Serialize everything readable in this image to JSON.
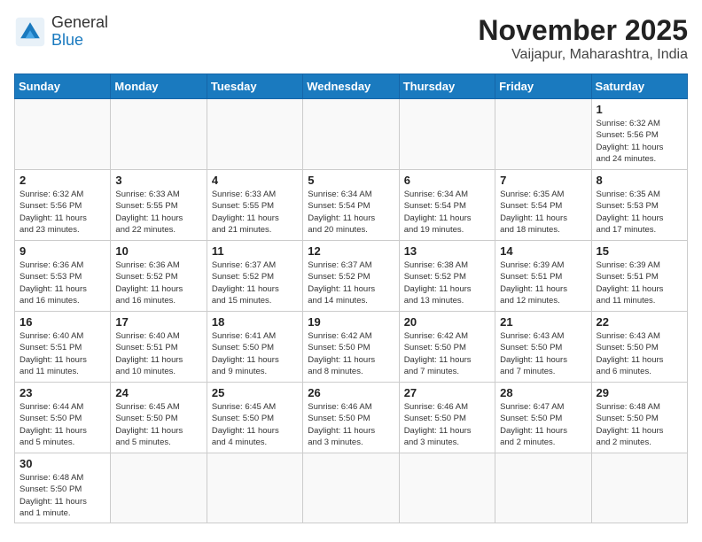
{
  "header": {
    "logo_general": "General",
    "logo_blue": "Blue",
    "month_title": "November 2025",
    "location": "Vaijapur, Maharashtra, India"
  },
  "days_of_week": [
    "Sunday",
    "Monday",
    "Tuesday",
    "Wednesday",
    "Thursday",
    "Friday",
    "Saturday"
  ],
  "weeks": [
    [
      {
        "day": "",
        "info": ""
      },
      {
        "day": "",
        "info": ""
      },
      {
        "day": "",
        "info": ""
      },
      {
        "day": "",
        "info": ""
      },
      {
        "day": "",
        "info": ""
      },
      {
        "day": "",
        "info": ""
      },
      {
        "day": "1",
        "info": "Sunrise: 6:32 AM\nSunset: 5:56 PM\nDaylight: 11 hours\nand 24 minutes."
      }
    ],
    [
      {
        "day": "2",
        "info": "Sunrise: 6:32 AM\nSunset: 5:56 PM\nDaylight: 11 hours\nand 23 minutes."
      },
      {
        "day": "3",
        "info": "Sunrise: 6:33 AM\nSunset: 5:55 PM\nDaylight: 11 hours\nand 22 minutes."
      },
      {
        "day": "4",
        "info": "Sunrise: 6:33 AM\nSunset: 5:55 PM\nDaylight: 11 hours\nand 21 minutes."
      },
      {
        "day": "5",
        "info": "Sunrise: 6:34 AM\nSunset: 5:54 PM\nDaylight: 11 hours\nand 20 minutes."
      },
      {
        "day": "6",
        "info": "Sunrise: 6:34 AM\nSunset: 5:54 PM\nDaylight: 11 hours\nand 19 minutes."
      },
      {
        "day": "7",
        "info": "Sunrise: 6:35 AM\nSunset: 5:54 PM\nDaylight: 11 hours\nand 18 minutes."
      },
      {
        "day": "8",
        "info": "Sunrise: 6:35 AM\nSunset: 5:53 PM\nDaylight: 11 hours\nand 17 minutes."
      }
    ],
    [
      {
        "day": "9",
        "info": "Sunrise: 6:36 AM\nSunset: 5:53 PM\nDaylight: 11 hours\nand 16 minutes."
      },
      {
        "day": "10",
        "info": "Sunrise: 6:36 AM\nSunset: 5:52 PM\nDaylight: 11 hours\nand 16 minutes."
      },
      {
        "day": "11",
        "info": "Sunrise: 6:37 AM\nSunset: 5:52 PM\nDaylight: 11 hours\nand 15 minutes."
      },
      {
        "day": "12",
        "info": "Sunrise: 6:37 AM\nSunset: 5:52 PM\nDaylight: 11 hours\nand 14 minutes."
      },
      {
        "day": "13",
        "info": "Sunrise: 6:38 AM\nSunset: 5:52 PM\nDaylight: 11 hours\nand 13 minutes."
      },
      {
        "day": "14",
        "info": "Sunrise: 6:39 AM\nSunset: 5:51 PM\nDaylight: 11 hours\nand 12 minutes."
      },
      {
        "day": "15",
        "info": "Sunrise: 6:39 AM\nSunset: 5:51 PM\nDaylight: 11 hours\nand 11 minutes."
      }
    ],
    [
      {
        "day": "16",
        "info": "Sunrise: 6:40 AM\nSunset: 5:51 PM\nDaylight: 11 hours\nand 11 minutes."
      },
      {
        "day": "17",
        "info": "Sunrise: 6:40 AM\nSunset: 5:51 PM\nDaylight: 11 hours\nand 10 minutes."
      },
      {
        "day": "18",
        "info": "Sunrise: 6:41 AM\nSunset: 5:50 PM\nDaylight: 11 hours\nand 9 minutes."
      },
      {
        "day": "19",
        "info": "Sunrise: 6:42 AM\nSunset: 5:50 PM\nDaylight: 11 hours\nand 8 minutes."
      },
      {
        "day": "20",
        "info": "Sunrise: 6:42 AM\nSunset: 5:50 PM\nDaylight: 11 hours\nand 7 minutes."
      },
      {
        "day": "21",
        "info": "Sunrise: 6:43 AM\nSunset: 5:50 PM\nDaylight: 11 hours\nand 7 minutes."
      },
      {
        "day": "22",
        "info": "Sunrise: 6:43 AM\nSunset: 5:50 PM\nDaylight: 11 hours\nand 6 minutes."
      }
    ],
    [
      {
        "day": "23",
        "info": "Sunrise: 6:44 AM\nSunset: 5:50 PM\nDaylight: 11 hours\nand 5 minutes."
      },
      {
        "day": "24",
        "info": "Sunrise: 6:45 AM\nSunset: 5:50 PM\nDaylight: 11 hours\nand 5 minutes."
      },
      {
        "day": "25",
        "info": "Sunrise: 6:45 AM\nSunset: 5:50 PM\nDaylight: 11 hours\nand 4 minutes."
      },
      {
        "day": "26",
        "info": "Sunrise: 6:46 AM\nSunset: 5:50 PM\nDaylight: 11 hours\nand 3 minutes."
      },
      {
        "day": "27",
        "info": "Sunrise: 6:46 AM\nSunset: 5:50 PM\nDaylight: 11 hours\nand 3 minutes."
      },
      {
        "day": "28",
        "info": "Sunrise: 6:47 AM\nSunset: 5:50 PM\nDaylight: 11 hours\nand 2 minutes."
      },
      {
        "day": "29",
        "info": "Sunrise: 6:48 AM\nSunset: 5:50 PM\nDaylight: 11 hours\nand 2 minutes."
      }
    ],
    [
      {
        "day": "30",
        "info": "Sunrise: 6:48 AM\nSunset: 5:50 PM\nDaylight: 11 hours\nand 1 minute."
      },
      {
        "day": "",
        "info": ""
      },
      {
        "day": "",
        "info": ""
      },
      {
        "day": "",
        "info": ""
      },
      {
        "day": "",
        "info": ""
      },
      {
        "day": "",
        "info": ""
      },
      {
        "day": "",
        "info": ""
      }
    ]
  ]
}
